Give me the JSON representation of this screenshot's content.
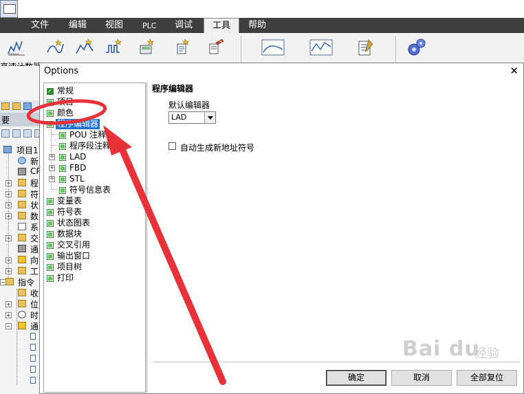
{
  "menu": {
    "items": [
      {
        "label": "文件"
      },
      {
        "label": "编辑"
      },
      {
        "label": "视图"
      },
      {
        "label": "PLC"
      },
      {
        "label": "调试"
      },
      {
        "label": "工具"
      },
      {
        "label": "帮助"
      }
    ],
    "active": "工具"
  },
  "ribbon": {
    "first_label": "高速计数器"
  },
  "left_panel": {
    "header": "要",
    "tree": [
      {
        "label": "项目1"
      },
      {
        "label": "新"
      },
      {
        "label": "CP"
      },
      {
        "label": "程"
      },
      {
        "label": "符"
      },
      {
        "label": "状"
      },
      {
        "label": "数"
      },
      {
        "label": "系"
      },
      {
        "label": "交"
      },
      {
        "label": "通"
      },
      {
        "label": "向"
      },
      {
        "label": "工"
      },
      {
        "label": "指令"
      },
      {
        "label": "收"
      },
      {
        "label": "位"
      },
      {
        "label": "时"
      },
      {
        "label": "通"
      }
    ]
  },
  "dialog": {
    "title": "Options",
    "close_glyph": "✕",
    "tree": {
      "general": "常规",
      "project": "项目",
      "color": "颜色",
      "program_editor": "程序编辑器",
      "pou_comment": "POU 注释",
      "segment_comment": "程序段注释",
      "lad": "LAD",
      "fbd": "FBD",
      "stl": "STL",
      "symbol_info_table": "符号信息表",
      "variable_table": "变量表",
      "symbol_table": "符号表",
      "status_chart": "状态图表",
      "data_block": "数据块",
      "cross_reference": "交叉引用",
      "output_window": "输出窗口",
      "project_tree": "项目树",
      "print": "打印"
    },
    "pane": {
      "section_title": "程序编辑器",
      "default_editor_label": "默认编辑器",
      "default_editor_value": "LAD",
      "auto_symbol_label": "自动生成新地址符号",
      "auto_symbol_checked": false
    },
    "buttons": {
      "ok": "确定",
      "cancel": "取消",
      "reset_all": "全部复位"
    }
  },
  "watermark": {
    "main": "Bai du",
    "sub": "经验"
  },
  "colors": {
    "menubar": "#3f3f3f",
    "selection": "#1f6fd0",
    "annotation_red": "#e8323a",
    "checkbox_green": "#61c561"
  }
}
